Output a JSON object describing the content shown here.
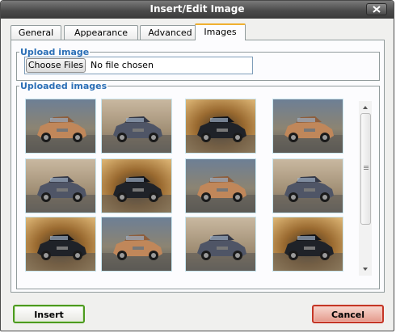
{
  "window": {
    "title": "Insert/Edit Image"
  },
  "tabs": [
    {
      "label": "General"
    },
    {
      "label": "Appearance"
    },
    {
      "label": "Advanced"
    },
    {
      "label": "Images",
      "active": true
    }
  ],
  "upload": {
    "legend": "Upload image",
    "choose_label": "Choose Files",
    "status": "No file chosen"
  },
  "gallery": {
    "legend": "Uploaded images",
    "thumbnails": [
      {
        "icon": "copper-suv-photo"
      },
      {
        "icon": "gray-suv-photo"
      },
      {
        "icon": "black-suv-motion-photo"
      },
      {
        "icon": "copper-suv-photo"
      },
      {
        "icon": "gray-suv-photo"
      },
      {
        "icon": "black-suv-motion-photo"
      },
      {
        "icon": "copper-suv-photo"
      },
      {
        "icon": "gray-suv-photo"
      },
      {
        "icon": "black-suv-motion-photo"
      },
      {
        "icon": "copper-suv-photo"
      },
      {
        "icon": "gray-suv-photo"
      },
      {
        "icon": "black-suv-motion-photo"
      }
    ]
  },
  "footer": {
    "insert_label": "Insert",
    "cancel_label": "Cancel"
  },
  "colors": {
    "legend": "#2b6fb6",
    "insert_border": "#4d9b1f",
    "cancel_border": "#c43626",
    "active_tab": "#f0b030"
  }
}
